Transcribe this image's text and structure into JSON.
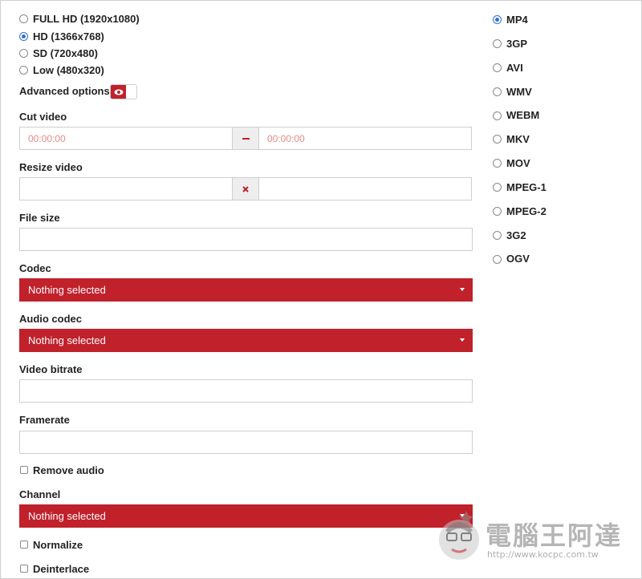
{
  "resolution": {
    "options": [
      {
        "label": "FULL HD (1920x1080)",
        "selected": false
      },
      {
        "label": "HD (1366x768)",
        "selected": true
      },
      {
        "label": "SD (720x480)",
        "selected": false
      },
      {
        "label": "Low (480x320)",
        "selected": false
      }
    ]
  },
  "advanced": {
    "label": "Advanced options:",
    "enabled": true,
    "icon": "eye-icon"
  },
  "cut_video": {
    "label": "Cut video",
    "start_placeholder": "00:00:00",
    "end_placeholder": "00:00:00",
    "separator_icon": "minus-icon"
  },
  "resize_video": {
    "label": "Resize video",
    "width_value": "",
    "height_value": "",
    "separator_icon": "close-icon"
  },
  "file_size": {
    "label": "File size",
    "value": ""
  },
  "codec": {
    "label": "Codec",
    "selected": "Nothing selected"
  },
  "audio_codec": {
    "label": "Audio codec",
    "selected": "Nothing selected"
  },
  "video_bitrate": {
    "label": "Video bitrate",
    "value": ""
  },
  "framerate": {
    "label": "Framerate",
    "value": ""
  },
  "remove_audio": {
    "label": "Remove audio",
    "checked": false
  },
  "channel": {
    "label": "Channel",
    "selected": "Nothing selected"
  },
  "normalize": {
    "label": "Normalize",
    "checked": false
  },
  "deinterlace": {
    "label": "Deinterlace",
    "checked": false
  },
  "formats": {
    "options": [
      {
        "label": "MP4",
        "selected": true
      },
      {
        "label": "3GP",
        "selected": false
      },
      {
        "label": "AVI",
        "selected": false
      },
      {
        "label": "WMV",
        "selected": false
      },
      {
        "label": "WEBM",
        "selected": false
      },
      {
        "label": "MKV",
        "selected": false
      },
      {
        "label": "MOV",
        "selected": false
      },
      {
        "label": "MPEG-1",
        "selected": false
      },
      {
        "label": "MPEG-2",
        "selected": false
      },
      {
        "label": "3G2",
        "selected": false
      },
      {
        "label": "OGV",
        "selected": false
      }
    ]
  },
  "watermark": {
    "title": "電腦王阿達",
    "url": "http://www.kocpc.com.tw"
  },
  "colors": {
    "accent": "#c0212b",
    "radio_selected": "#2f72d6"
  }
}
